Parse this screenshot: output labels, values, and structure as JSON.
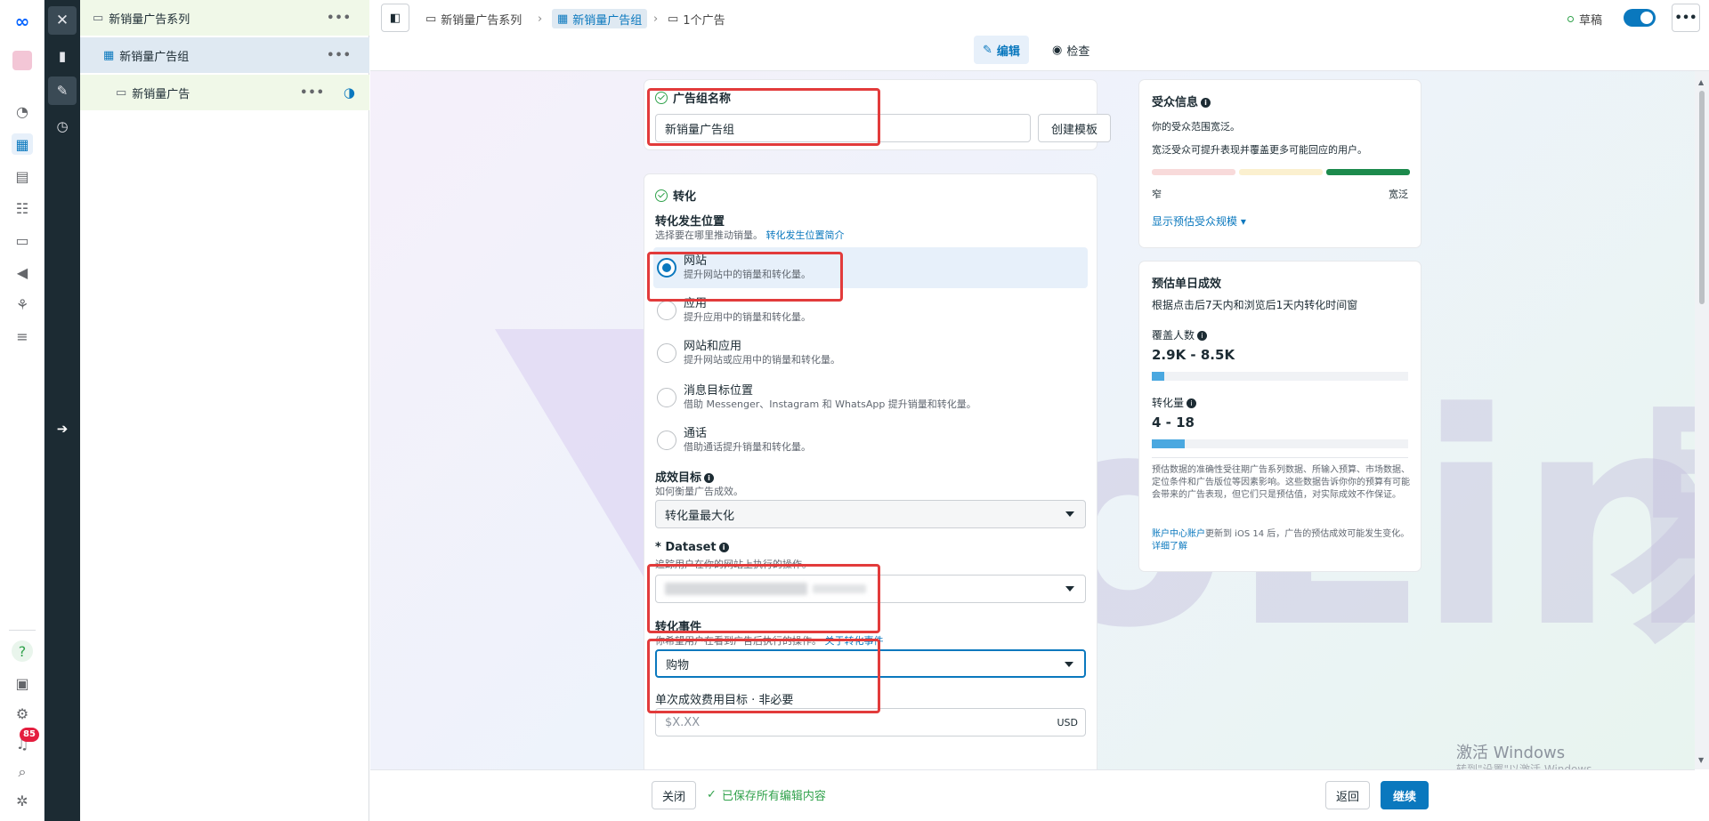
{
  "tree": {
    "campaign": "新销量广告系列",
    "adset": "新销量广告组",
    "ad": "新销量广告"
  },
  "breadcrumb": {
    "campaign": "新销量广告系列",
    "adset": "新销量广告组",
    "ads": "1个广告"
  },
  "status": {
    "draft": "草稿"
  },
  "modes": {
    "edit": "编辑",
    "review": "检查"
  },
  "notification_count": "85",
  "adset_name": {
    "title": "广告组名称",
    "value": "新销量广告组",
    "template_button": "创建模板"
  },
  "conversion": {
    "title": "转化",
    "location_title": "转化发生位置",
    "location_desc": "选择要在哪里推动销量。",
    "location_link": "转化发生位置简介",
    "options": [
      {
        "label": "网站",
        "desc": "提升网站中的销量和转化量。",
        "selected": true
      },
      {
        "label": "应用",
        "desc": "提升应用中的销量和转化量。",
        "selected": false
      },
      {
        "label": "网站和应用",
        "desc": "提升网站或应用中的销量和转化量。",
        "selected": false
      },
      {
        "label": "消息目标位置",
        "desc": "借助 Messenger、Instagram 和 WhatsApp 提升销量和转化量。",
        "selected": false
      },
      {
        "label": "通话",
        "desc": "借助通话提升销量和转化量。",
        "selected": false
      }
    ],
    "goal_title": "成效目标",
    "goal_desc": "如何衡量广告成效。",
    "goal_value": "转化量最大化",
    "dataset_title": "* Dataset",
    "dataset_desc": "追踪用户在你的网站上执行的操作。",
    "event_title": "转化事件",
    "event_desc": "你希望用户在看到广告后执行的操作。",
    "event_link": "关于转化事件",
    "event_value": "购物",
    "cost_title": "单次成效费用目标 · 非必要",
    "cost_placeholder": "$X.XX",
    "cost_currency": "USD"
  },
  "audience": {
    "title": "受众信息",
    "line1": "你的受众范围宽泛。",
    "line2": "宽泛受众可提升表现并覆盖更多可能回应的用户。",
    "narrow": "窄",
    "broad": "宽泛",
    "link": "显示预估受众规模"
  },
  "estimates": {
    "title": "预估单日成效",
    "desc": "根据点击后7天内和浏览后1天内转化时间窗",
    "reach_label": "覆盖人数",
    "reach_value": "2.9K - 8.5K",
    "reach_fill": 0.05,
    "conv_label": "转化量",
    "conv_value": "4 - 18",
    "conv_fill": 0.13,
    "note": "预估数据的准确性受往期广告系列数据、所输入预算、市场数据、定位条件和广告版位等因素影响。这些数据告诉你你的预算有可能会带来的广告表现，但它们只是预估值，对实际成效不作保证。",
    "ios_prefix": "账户中心账户",
    "ios_text": "更新到 iOS 14 后，广告的预估成效可能发生变化。",
    "ios_link": "详细了解"
  },
  "footer": {
    "close": "关闭",
    "saved": "已保存所有编辑内容",
    "back": "返回",
    "continue": "继续"
  },
  "watermark": {
    "brand": "YinoLink易诺"
  },
  "windows": {
    "line1": "激活 Windows",
    "line2": "转到\"设置\"以激活 Windows。"
  },
  "colors": {
    "accent": "#0a78be",
    "red_highlight": "#e23b3b",
    "success": "#31a24c",
    "dark_rail": "#1c2b33"
  }
}
